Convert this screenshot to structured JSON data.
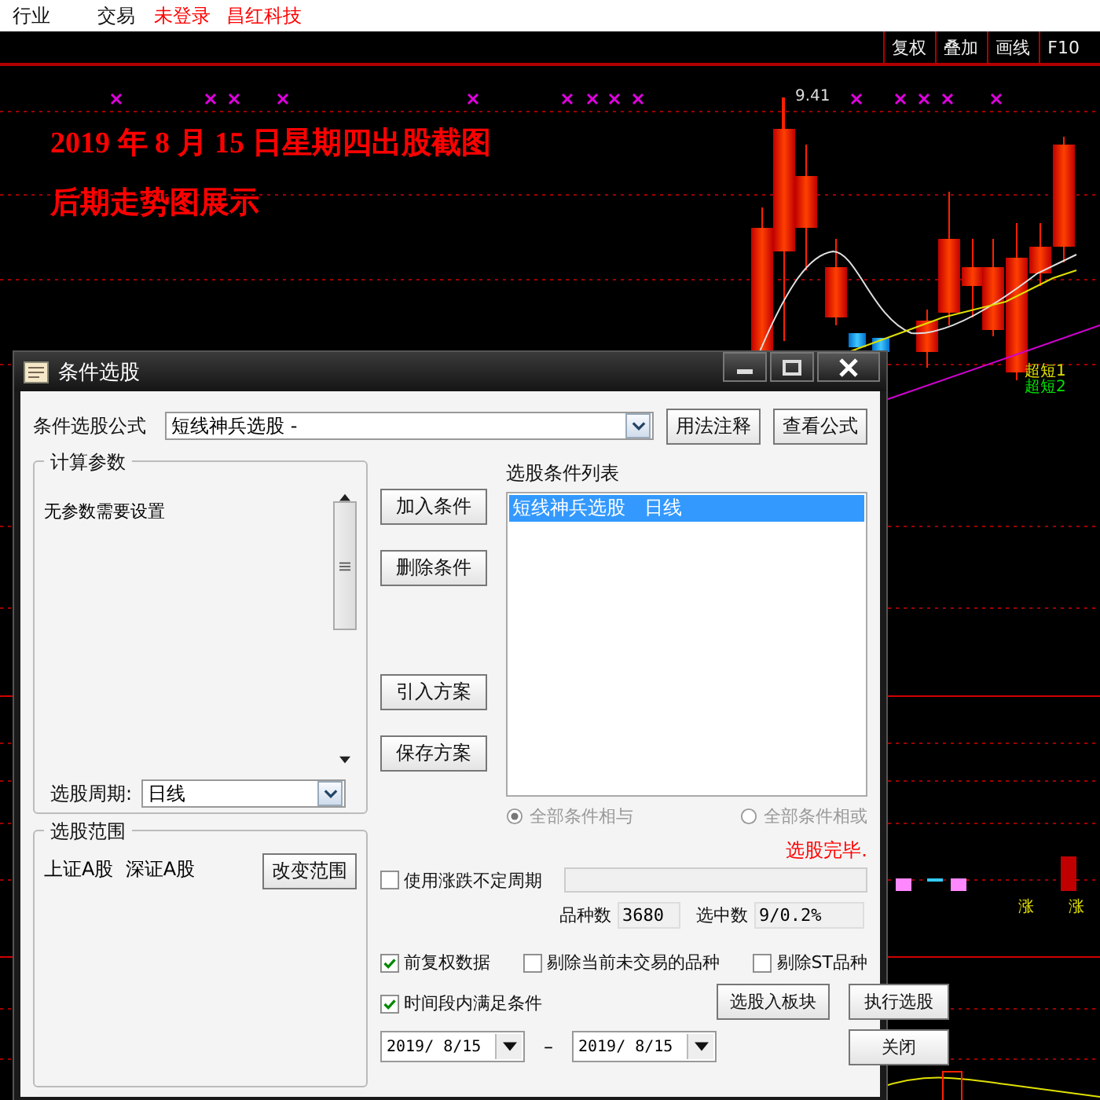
{
  "menu": [
    {
      "label": "行业",
      "kind": "plain"
    },
    {
      "label": "交易",
      "kind": "plain"
    },
    {
      "label": "未登录",
      "kind": "alert"
    },
    {
      "label": "昌红科技",
      "kind": "alert"
    }
  ],
  "toolbar": [
    "复权",
    "叠加",
    "画线",
    "F10"
  ],
  "chart": {
    "headline": [
      "2019 年 8 月 15 日星期四出股截图",
      "后期走势图展示"
    ],
    "price_label": "9.41",
    "signal_labels": [
      "超短1",
      "超短2"
    ],
    "volume_labels": [
      "涨",
      "涨"
    ]
  },
  "dialog": {
    "title": "条件选股",
    "formula_label": "条件选股公式",
    "formula": "短线神兵选股 -",
    "top_buttons": [
      "用法注释",
      "查看公式"
    ],
    "params": {
      "legend": "计算参数",
      "message": "无参数需要设置",
      "period_label": "选股周期:",
      "period": "日线"
    },
    "range": {
      "legend": "选股范围",
      "markets": "上证A股  深证A股",
      "button": "改变范围"
    },
    "side_buttons": [
      "加入条件",
      "删除条件",
      "引入方案",
      "保存方案"
    ],
    "conditions": {
      "label": "选股条件列表",
      "items": [
        {
          "text": "短线神兵选股　日线",
          "selected": true
        }
      ]
    },
    "logic": [
      {
        "label": "全部条件相与",
        "selected": true,
        "disabled": true
      },
      {
        "label": "全部条件相或",
        "selected": false,
        "disabled": true
      }
    ],
    "status": "选股完毕.",
    "variable_period": {
      "label": "使用涨跌不定周期",
      "checked": false
    },
    "count_label": "品种数",
    "count": "3680",
    "selected_label": "选中数",
    "selected_count": "9/0.2%",
    "filters": [
      {
        "label": "前复权数据",
        "checked": true
      },
      {
        "label": "剔除当前未交易的品种",
        "checked": false
      },
      {
        "label": "剔除ST品种",
        "checked": false
      }
    ],
    "time_range": {
      "label": "时间段内满足条件",
      "checked": true,
      "from": "2019/ 8/15",
      "separator": "–",
      "to": "2019/ 8/15"
    },
    "action_buttons": [
      "选股入板块",
      "执行选股",
      "关闭"
    ]
  }
}
